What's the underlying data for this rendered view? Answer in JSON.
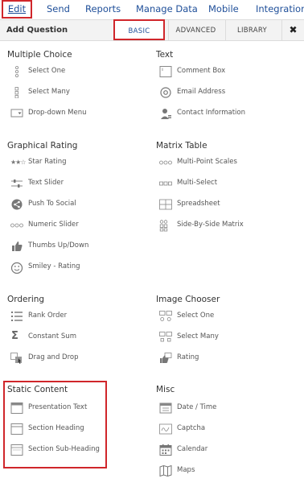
{
  "nav": {
    "items": [
      "Edit",
      "Send",
      "Reports",
      "Manage Data",
      "Mobile",
      "Integration"
    ]
  },
  "toolbar": {
    "title": "Add Question",
    "tabs": [
      "BASIC",
      "ADVANCED",
      "LIBRARY"
    ],
    "close": "✖"
  },
  "sections": {
    "multiple_choice": {
      "title": "Multiple Choice",
      "items": [
        "Select One",
        "Select Many",
        "Drop-down Menu"
      ]
    },
    "text": {
      "title": "Text",
      "items": [
        "Comment Box",
        "Email Address",
        "Contact Information"
      ]
    },
    "graphical_rating": {
      "title": "Graphical Rating",
      "items": [
        "Star Rating",
        "Text Slider",
        "Push To Social",
        "Numeric Slider",
        "Thumbs Up/Down",
        "Smiley - Rating"
      ]
    },
    "matrix_table": {
      "title": "Matrix Table",
      "items": [
        "Multi-Point Scales",
        "Multi-Select",
        "Spreadsheet",
        "Side-By-Side Matrix"
      ]
    },
    "ordering": {
      "title": "Ordering",
      "items": [
        "Rank Order",
        "Constant Sum",
        "Drag and Drop"
      ]
    },
    "image_chooser": {
      "title": "Image Chooser",
      "items": [
        "Select One",
        "Select Many",
        "Rating"
      ]
    },
    "static_content": {
      "title": "Static Content",
      "items": [
        "Presentation Text",
        "Section Heading",
        "Section Sub-Heading"
      ]
    },
    "misc": {
      "title": "Misc",
      "items": [
        "Date / Time",
        "Captcha",
        "Calendar",
        "Maps"
      ]
    }
  },
  "colors": {
    "nav_link": "#1f4f99",
    "highlight": "#d0262b",
    "icon": "#777777",
    "toolbar_bg": "#f3f3f3"
  }
}
